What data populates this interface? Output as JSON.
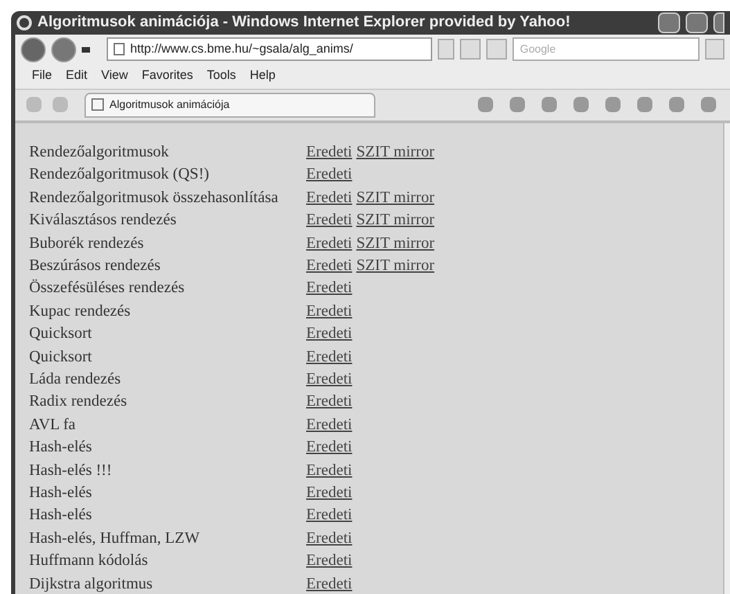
{
  "window": {
    "title": "Algoritmusok animációja - Windows Internet Explorer provided by Yahoo!"
  },
  "address_bar": {
    "url": "http://www.cs.bme.hu/~gsala/alg_anims/"
  },
  "search": {
    "placeholder": "Google"
  },
  "menu": [
    "File",
    "Edit",
    "View",
    "Favorites",
    "Tools",
    "Help"
  ],
  "tab": {
    "title": "Algoritmusok animációja"
  },
  "rows": [
    {
      "name": "Rendezőalgoritmusok",
      "links": [
        "Eredeti",
        "SZIT mirror"
      ]
    },
    {
      "name": "Rendezőalgoritmusok (QS!)",
      "links": [
        "Eredeti"
      ]
    },
    {
      "name": "Rendezőalgoritmusok összehasonlítása",
      "links": [
        "Eredeti",
        "SZIT mirror"
      ]
    },
    {
      "name": "Kiválasztásos rendezés",
      "links": [
        "Eredeti",
        "SZIT mirror"
      ]
    },
    {
      "name": "Buborék rendezés",
      "links": [
        "Eredeti",
        "SZIT mirror"
      ]
    },
    {
      "name": "Beszúrásos rendezés",
      "links": [
        "Eredeti",
        "SZIT mirror"
      ]
    },
    {
      "name": "Összefésüléses rendezés",
      "links": [
        "Eredeti"
      ]
    },
    {
      "name": "Kupac rendezés",
      "links": [
        "Eredeti"
      ]
    },
    {
      "name": "Quicksort",
      "links": [
        "Eredeti"
      ]
    },
    {
      "name": "Quicksort",
      "links": [
        "Eredeti"
      ]
    },
    {
      "name": "Láda rendezés",
      "links": [
        "Eredeti"
      ]
    },
    {
      "name": "Radix rendezés",
      "links": [
        "Eredeti"
      ]
    },
    {
      "name": "AVL fa",
      "links": [
        "Eredeti"
      ]
    },
    {
      "name": "Hash-elés",
      "links": [
        "Eredeti"
      ]
    },
    {
      "name": "Hash-elés !!!",
      "links": [
        "Eredeti"
      ]
    },
    {
      "name": "Hash-elés",
      "links": [
        "Eredeti"
      ]
    },
    {
      "name": "Hash-elés",
      "links": [
        "Eredeti"
      ]
    },
    {
      "name": "Hash-elés, Huffman, LZW",
      "links": [
        "Eredeti"
      ]
    },
    {
      "name": "Huffmann kódolás",
      "links": [
        "Eredeti"
      ]
    },
    {
      "name": "Dijkstra algoritmus",
      "links": [
        "Eredeti"
      ]
    }
  ]
}
